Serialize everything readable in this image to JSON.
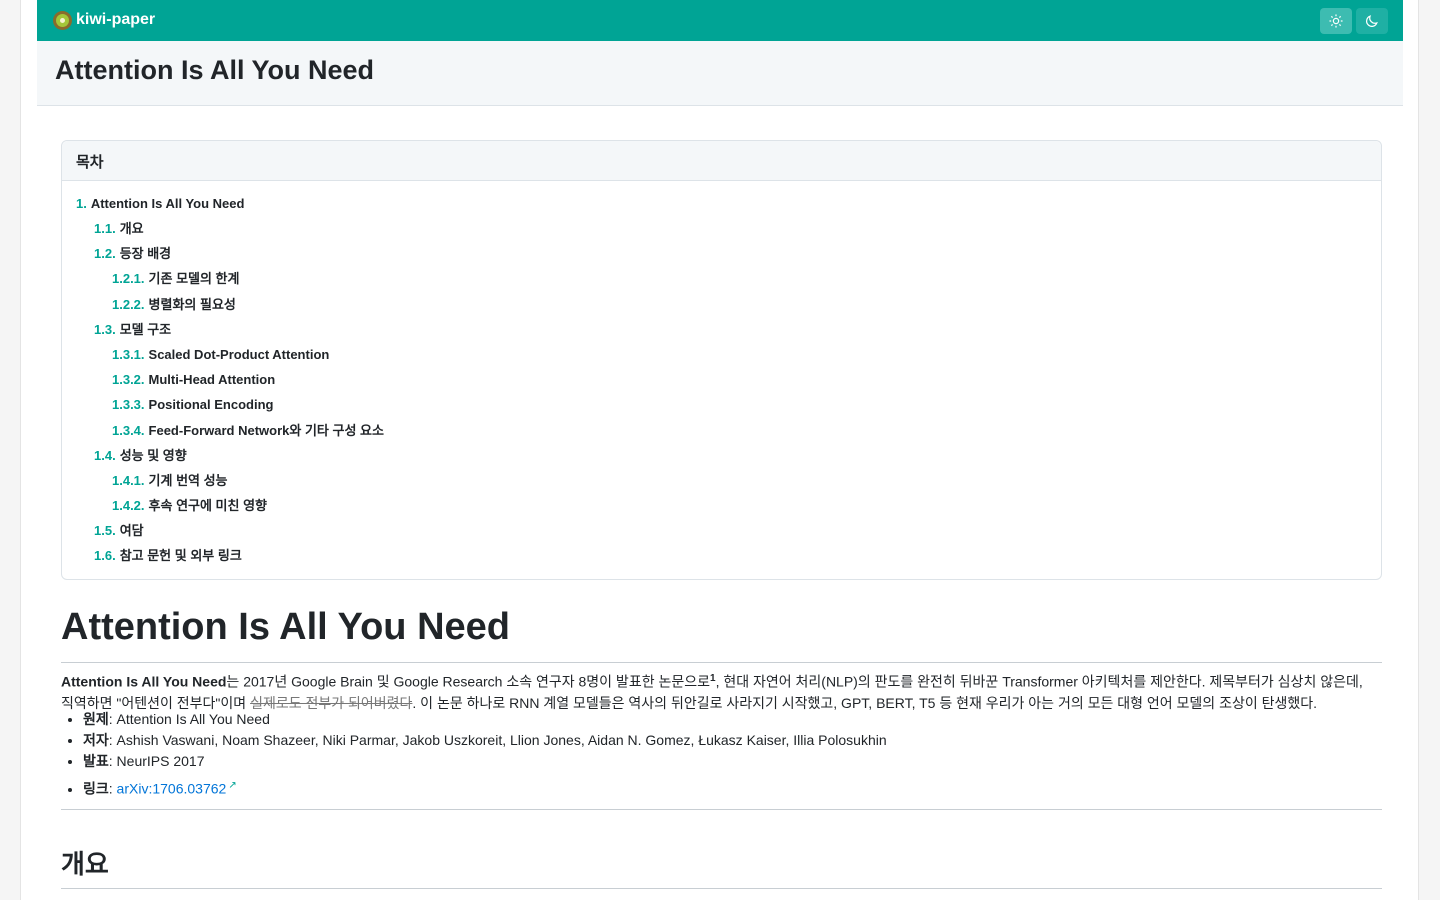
{
  "app": {
    "name": "kiwi-paper"
  },
  "header": {
    "light_icon": "sun-icon",
    "dark_icon": "moon-icon",
    "title": "Attention Is All You Need"
  },
  "toc": {
    "heading": "목차",
    "items": [
      {
        "num": "1.",
        "label": "Attention Is All You Need"
      },
      {
        "num": "1.1.",
        "label": "개요"
      },
      {
        "num": "1.2.",
        "label": "등장 배경"
      },
      {
        "num": "1.2.1.",
        "label": "기존 모델의 한계"
      },
      {
        "num": "1.2.2.",
        "label": "병렬화의 필요성"
      },
      {
        "num": "1.3.",
        "label": "모델 구조"
      },
      {
        "num": "1.3.1.",
        "label": "Scaled Dot-Product Attention"
      },
      {
        "num": "1.3.2.",
        "label": "Multi-Head Attention"
      },
      {
        "num": "1.3.3.",
        "label": "Positional Encoding"
      },
      {
        "num": "1.3.4.",
        "label": "Feed-Forward Network와 기타 구성 요소"
      },
      {
        "num": "1.4.",
        "label": "성능 및 영향"
      },
      {
        "num": "1.4.1.",
        "label": "기계 번역 성능"
      },
      {
        "num": "1.4.2.",
        "label": "후속 연구에 미친 영향"
      },
      {
        "num": "1.5.",
        "label": "여담"
      },
      {
        "num": "1.6.",
        "label": "참고 문헌 및 외부 링크"
      }
    ]
  },
  "article": {
    "h1": "Attention Is All You Need",
    "intro": {
      "bold_title": "Attention Is All You Need",
      "text1": "는 2017년 Google Brain 및 Google Research 소속 연구자 8명이 발표한 논문으로",
      "footnote": "1",
      "text2": ", 현대 자연어 처리(NLP)의 판도를 완전히 뒤바꾼 Transformer 아키텍처를 제안한다. 제목부터가 심상치 않은데, 직역하면 \"어텐션이 전부다\"이며 ",
      "strike": "실제로도 전부가 되어버렸다",
      "text3": ". 이 논문 하나로 RNN 계열 모델들은 역사의 뒤안길로 사라지기 시작했고, GPT, BERT, T5 등 현재 우리가 아는 거의 모든 대형 언어 모델의 조상이 탄생했다."
    },
    "info": [
      {
        "label": "원제",
        "value": ": Attention Is All You Need"
      },
      {
        "label": "저자",
        "value": ": Ashish Vaswani, Noam Shazeer, Niki Parmar, Jakob Uszkoreit, Llion Jones, Aidan N. Gomez, Łukasz Kaiser, Illia Polosukhin"
      },
      {
        "label": "발표",
        "value": ": NeurIPS 2017"
      }
    ],
    "link": {
      "label": "링크",
      "sep": ": ",
      "text": "arXiv:1706.03762",
      "mark": "↗"
    },
    "h2": "개요"
  },
  "colors": {
    "accent": "#00a495",
    "link": "#0275d8"
  }
}
